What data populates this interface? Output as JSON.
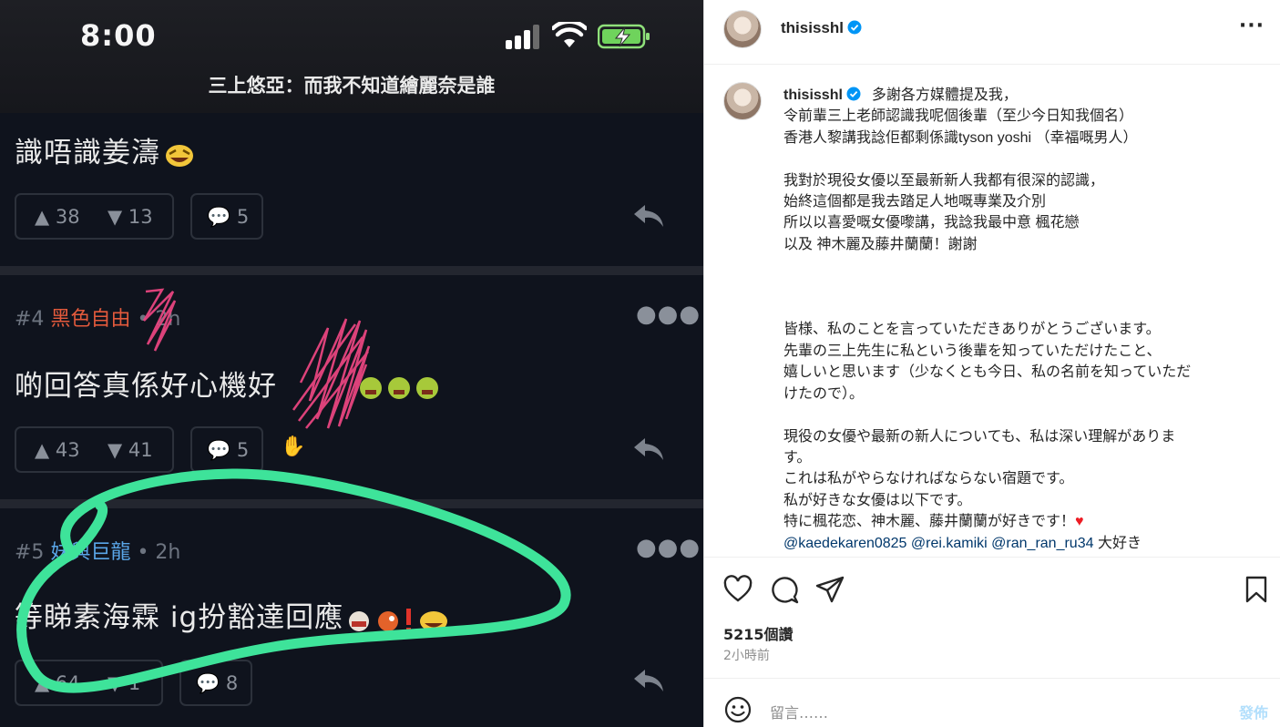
{
  "phone": {
    "time": "8:00",
    "title": "三上悠亞：而我不知道繪麗奈是誰"
  },
  "posts": [
    {
      "text": "識唔識姜濤",
      "emoji": "laughing-face-icon",
      "up": "38",
      "down": "13",
      "comments": "5"
    },
    {
      "number": "#4",
      "author": "黑色自由",
      "time": "• 2h",
      "text": "啲回答真係好心機好",
      "up": "43",
      "down": "41",
      "comments": "5"
    },
    {
      "number": "#5",
      "author": "妹與巨龍",
      "time": "• 2h",
      "text": "等睇素海霖 ig扮豁達回應",
      "up": "64",
      "down": "1",
      "comments": "8"
    }
  ],
  "ig": {
    "username": "thisisshl",
    "more": "···",
    "caption_lines": [
      "多謝各方媒體提及我，",
      "令前輩三上老師認識我呢個後輩（至少今日知我個名）",
      "香港人黎講我諗佢都剩係識tyson yoshi （幸福嘅男人）",
      "",
      "我對於現役女優以至最新新人我都有很深的認識，",
      "始終這個都是我去踏足人地嘅專業及介別",
      "所以以喜愛嘅女優嚟講，我諗我最中意 楓花戀",
      "以及 神木麗及藤井蘭蘭！謝謝",
      "",
      "",
      "",
      "皆様、私のことを言っていただきありがとうございます。",
      "先輩の三上先生に私という後輩を知っていただけたこと、",
      "嬉しいと思います（少なくとも今日、私の名前を知っていただ",
      "けたので）。",
      "",
      "現役の女優や最新の新人についても、私は深い理解がありま",
      "す。",
      "これは私がやらなければならない宿題です。",
      "私が好きな女優は以下です。"
    ],
    "line_special": "特に楓花恋、神木麗、藤井蘭蘭が好きです！",
    "heart": "♥",
    "mentions": [
      "@kaedekaren0825",
      "@rei.kamiki",
      "@ran_ran_ru34"
    ],
    "mentions_suffix": "大好き",
    "likes": "5215個讚",
    "time_ago": "2小時前",
    "comment_placeholder": "留言……",
    "post_label": "發佈",
    "colors": {
      "link": "#00376b",
      "verified": "#0095f6",
      "green_marker": "#3ee39a",
      "pink_marker": "#e8457f"
    }
  }
}
